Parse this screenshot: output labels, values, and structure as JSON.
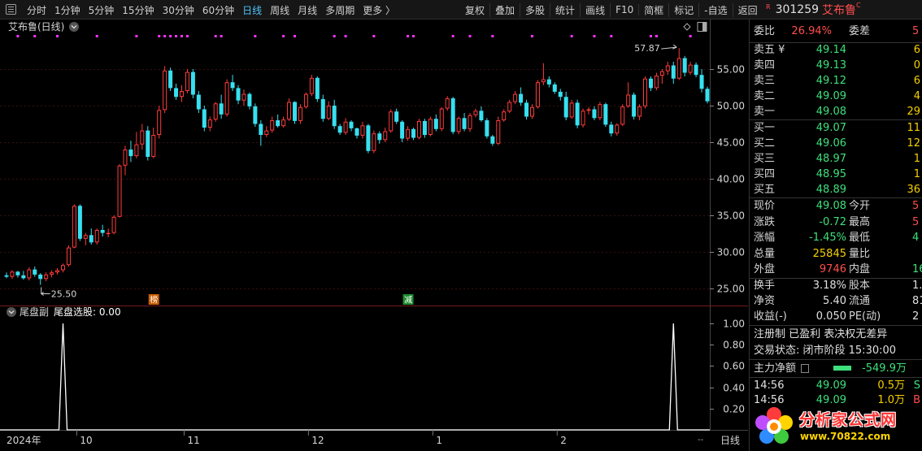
{
  "toolbar": {
    "periods": [
      "分时",
      "1分钟",
      "5分钟",
      "15分钟",
      "30分钟",
      "60分钟",
      "日线",
      "周线",
      "月线",
      "多周期",
      "更多 〉"
    ],
    "active_period": "日线",
    "tools": [
      "复权",
      "叠加",
      "多股",
      "统计",
      "画线",
      "F10",
      "简框",
      "标记",
      "-自选",
      "返回"
    ]
  },
  "stock": {
    "badge": "R",
    "code": "301259",
    "name": "艾布鲁",
    "suffix": "C"
  },
  "main_chart": {
    "title": "艾布鲁(日线)",
    "marker_bang": "榜",
    "marker_jian": "减",
    "max_price_label": "57.87",
    "min_price_label": "25.50"
  },
  "sub_chart": {
    "title": "尾盘副",
    "indicator": "尾盘选股: 0.00"
  },
  "x_axis": {
    "labels": [
      "2024年",
      "10",
      "11",
      "12",
      "1",
      "2"
    ],
    "period_box": "日线",
    "end_marker": "--"
  },
  "colors": {
    "up": "#ff3b3b",
    "down": "#37e0f0",
    "grid": "#3a1010",
    "dots": "#ff33ff"
  },
  "chart_data": [
    {
      "type": "candlestick",
      "title": "艾布鲁(日线)",
      "ylim": [
        24,
        59
      ],
      "yticks": [
        25.0,
        30.0,
        35.0,
        40.0,
        45.0,
        50.0,
        55.0
      ],
      "annotations": [
        {
          "text": "57.87",
          "kind": "high"
        },
        {
          "text": "25.50",
          "kind": "low"
        }
      ],
      "series": [
        {
          "values_ohlc": [
            [
              26.8,
              27.2,
              26.4,
              26.6
            ],
            [
              26.6,
              27.5,
              26.3,
              27.3
            ],
            [
              27.3,
              27.4,
              26.5,
              26.8
            ],
            [
              26.8,
              27.4,
              26.2,
              26.4
            ],
            [
              26.4,
              27.9,
              26.1,
              27.6
            ],
            [
              27.6,
              28.0,
              26.6,
              26.9
            ],
            [
              26.9,
              27.1,
              25.5,
              26.3
            ],
            [
              26.3,
              27.2,
              26.0,
              26.9
            ],
            [
              26.9,
              27.5,
              26.5,
              27.2
            ],
            [
              27.2,
              27.8,
              26.9,
              27.5
            ],
            [
              27.5,
              28.4,
              27.2,
              28.2
            ],
            [
              28.2,
              30.9,
              28.0,
              30.6
            ],
            [
              30.6,
              36.5,
              30.5,
              36.3
            ],
            [
              36.3,
              36.5,
              31.5,
              31.8
            ],
            [
              31.8,
              32.6,
              30.9,
              32.3
            ],
            [
              32.3,
              33.2,
              31.0,
              31.3
            ],
            [
              31.3,
              33.2,
              31.0,
              33.0
            ],
            [
              33.0,
              33.7,
              32.1,
              32.6
            ],
            [
              32.6,
              33.2,
              32.0,
              32.6
            ],
            [
              32.6,
              35.0,
              32.4,
              34.8
            ],
            [
              34.8,
              42.0,
              34.7,
              41.8
            ],
            [
              41.8,
              44.5,
              40.5,
              44.0
            ],
            [
              44.0,
              45.2,
              42.3,
              43.1
            ],
            [
              43.1,
              46.4,
              42.8,
              44.7
            ],
            [
              44.7,
              47.5,
              44.0,
              46.6
            ],
            [
              46.6,
              47.2,
              42.5,
              43.0
            ],
            [
              43.0,
              47.0,
              42.8,
              46.0
            ],
            [
              46.0,
              50.0,
              45.5,
              49.4
            ],
            [
              49.4,
              55.4,
              49.0,
              54.8
            ],
            [
              54.8,
              55.2,
              52.0,
              52.4
            ],
            [
              52.4,
              53.0,
              50.8,
              51.2
            ],
            [
              51.2,
              52.8,
              50.5,
              52.0
            ],
            [
              52.0,
              55.0,
              51.7,
              54.6
            ],
            [
              54.6,
              55.0,
              51.0,
              51.5
            ],
            [
              51.5,
              52.0,
              49.0,
              49.5
            ],
            [
              49.5,
              50.0,
              46.5,
              47.0
            ],
            [
              47.0,
              48.5,
              46.5,
              48.1
            ],
            [
              48.1,
              50.5,
              47.8,
              50.3
            ],
            [
              50.3,
              51.5,
              48.2,
              48.8
            ],
            [
              48.8,
              53.6,
              48.5,
              53.2
            ],
            [
              53.2,
              54.2,
              52.0,
              52.4
            ],
            [
              52.4,
              52.8,
              50.2,
              50.7
            ],
            [
              50.7,
              52.2,
              50.0,
              51.6
            ],
            [
              51.6,
              51.8,
              49.5,
              49.9
            ],
            [
              49.9,
              50.3,
              47.1,
              47.5
            ],
            [
              47.5,
              48.0,
              44.5,
              46.0
            ],
            [
              46.0,
              47.2,
              45.7,
              46.6
            ],
            [
              46.6,
              48.5,
              46.3,
              48.0
            ],
            [
              48.0,
              48.8,
              47.0,
              47.2
            ],
            [
              47.2,
              48.5,
              47.0,
              48.1
            ],
            [
              48.1,
              51.0,
              47.9,
              50.5
            ],
            [
              50.5,
              50.6,
              47.5,
              47.9
            ],
            [
              47.9,
              50.2,
              47.5,
              49.8
            ],
            [
              49.8,
              51.8,
              49.6,
              51.6
            ],
            [
              51.6,
              54.2,
              51.3,
              53.8
            ],
            [
              53.8,
              54.0,
              50.5,
              50.9
            ],
            [
              50.9,
              51.5,
              47.8,
              48.2
            ],
            [
              48.2,
              50.6,
              48.0,
              50.0
            ],
            [
              50.0,
              50.8,
              46.8,
              47.2
            ],
            [
              47.2,
              47.5,
              46.0,
              46.3
            ],
            [
              46.3,
              48.3,
              46.0,
              47.8
            ],
            [
              47.8,
              48.0,
              46.5,
              46.9
            ],
            [
              46.9,
              47.0,
              45.5,
              45.9
            ],
            [
              45.9,
              47.8,
              45.5,
              47.3
            ],
            [
              47.3,
              47.5,
              43.5,
              43.8
            ],
            [
              43.8,
              46.6,
              43.5,
              46.2
            ],
            [
              46.2,
              46.5,
              44.8,
              45.3
            ],
            [
              45.3,
              47.0,
              45.0,
              46.5
            ],
            [
              46.5,
              49.5,
              46.3,
              49.2
            ],
            [
              49.2,
              49.6,
              47.5,
              47.8
            ],
            [
              47.8,
              48.0,
              45.0,
              45.5
            ],
            [
              45.5,
              47.2,
              45.2,
              46.8
            ],
            [
              46.8,
              47.0,
              45.3,
              45.6
            ],
            [
              45.6,
              48.2,
              45.4,
              47.9
            ],
            [
              47.9,
              48.2,
              45.6,
              46.0
            ],
            [
              46.0,
              48.5,
              45.8,
              48.2
            ],
            [
              48.2,
              48.8,
              46.5,
              46.8
            ],
            [
              46.8,
              49.8,
              46.5,
              49.6
            ],
            [
              49.6,
              51.3,
              49.3,
              51.0
            ],
            [
              51.0,
              51.2,
              46.1,
              46.4
            ],
            [
              46.4,
              48.5,
              46.1,
              48.3
            ],
            [
              48.3,
              49.0,
              46.5,
              46.8
            ],
            [
              46.8,
              49.0,
              46.4,
              48.7
            ],
            [
              48.7,
              49.6,
              48.4,
              49.3
            ],
            [
              49.3,
              49.9,
              47.8,
              48.0
            ],
            [
              48.0,
              48.3,
              45.5,
              45.8
            ],
            [
              45.8,
              46.0,
              44.5,
              44.8
            ],
            [
              44.8,
              48.5,
              44.6,
              48.0
            ],
            [
              48.0,
              49.5,
              47.8,
              49.2
            ],
            [
              49.2,
              50.8,
              49.0,
              50.5
            ],
            [
              50.5,
              52.0,
              50.2,
              51.6
            ],
            [
              51.6,
              52.5,
              50.0,
              50.4
            ],
            [
              50.4,
              50.8,
              48.1,
              48.5
            ],
            [
              48.5,
              50.2,
              48.2,
              49.8
            ],
            [
              49.8,
              53.5,
              49.6,
              53.2
            ],
            [
              53.2,
              55.8,
              52.8,
              53.6
            ],
            [
              53.6,
              54.0,
              52.5,
              52.9
            ],
            [
              52.9,
              53.2,
              51.6,
              51.9
            ],
            [
              51.9,
              52.3,
              50.7,
              51.2
            ],
            [
              51.2,
              51.9,
              48.0,
              48.4
            ],
            [
              48.4,
              50.8,
              48.2,
              50.4
            ],
            [
              50.4,
              50.8,
              46.9,
              47.3
            ],
            [
              47.3,
              49.6,
              47.0,
              49.3
            ],
            [
              49.3,
              49.8,
              48.8,
              49.5
            ],
            [
              49.5,
              49.9,
              48.0,
              48.3
            ],
            [
              48.3,
              50.5,
              48.0,
              50.2
            ],
            [
              50.2,
              50.4,
              47.1,
              47.4
            ],
            [
              47.4,
              47.8,
              45.8,
              46.2
            ],
            [
              46.2,
              47.6,
              45.9,
              47.4
            ],
            [
              47.4,
              50.2,
              47.2,
              49.9
            ],
            [
              49.9,
              53.2,
              49.7,
              51.5
            ],
            [
              51.5,
              51.8,
              48.1,
              48.5
            ],
            [
              48.5,
              50.2,
              48.0,
              49.9
            ],
            [
              49.9,
              54.0,
              49.6,
              53.7
            ],
            [
              53.7,
              54.0,
              52.0,
              52.4
            ],
            [
              52.4,
              54.5,
              52.1,
              54.1
            ],
            [
              54.1,
              55.0,
              53.0,
              54.7
            ],
            [
              54.7,
              56.0,
              54.2,
              55.5
            ],
            [
              55.5,
              56.0,
              53.0,
              53.7
            ],
            [
              53.7,
              57.87,
              53.5,
              56.5
            ],
            [
              56.5,
              56.8,
              54.0,
              54.5
            ],
            [
              54.5,
              56.0,
              54.2,
              55.6
            ],
            [
              55.6,
              55.9,
              53.9,
              54.2
            ],
            [
              54.2,
              55.0,
              51.8,
              52.3
            ],
            [
              52.3,
              52.6,
              50.3,
              50.6
            ]
          ]
        }
      ],
      "max": {
        "index": 119,
        "value": 57.87
      },
      "min": {
        "index": 6,
        "value": 25.5
      }
    },
    {
      "type": "line",
      "title": "尾盘副",
      "ylim": [
        0,
        1
      ],
      "yticks": [
        0.2,
        0.4,
        0.6,
        0.8,
        1.0
      ],
      "series": [
        {
          "name": "尾盘选股",
          "spikes_at": [
            10,
            118
          ],
          "baseline": 0,
          "peak": 1
        }
      ]
    }
  ],
  "panel": {
    "wb": {
      "label": "委比",
      "value": "26.94%",
      "label2": "委差",
      "value2": "5"
    },
    "sells": [
      {
        "label": "卖五 ¥",
        "price": "49.14",
        "vol": "6"
      },
      {
        "label": "卖四",
        "price": "49.13",
        "vol": "0"
      },
      {
        "label": "卖三",
        "price": "49.12",
        "vol": "6"
      },
      {
        "label": "卖二",
        "price": "49.09",
        "vol": "4"
      },
      {
        "label": "卖一",
        "price": "49.08",
        "vol": "29"
      }
    ],
    "buys": [
      {
        "label": "买一",
        "price": "49.07",
        "vol": "11"
      },
      {
        "label": "买二",
        "price": "49.06",
        "vol": "12"
      },
      {
        "label": "买三",
        "price": "48.97",
        "vol": "1"
      },
      {
        "label": "买四",
        "price": "48.95",
        "vol": "1"
      },
      {
        "label": "买五",
        "price": "48.89",
        "vol": "36"
      }
    ],
    "quote": [
      {
        "l1": "现价",
        "v1": "49.08",
        "c1": "green",
        "l2": "今开",
        "v2": "5",
        "c2": "red"
      },
      {
        "l1": "涨跌",
        "v1": "-0.72",
        "c1": "green",
        "l2": "最高",
        "v2": "5",
        "c2": "red"
      },
      {
        "l1": "涨幅",
        "v1": "-1.45%",
        "c1": "green",
        "l2": "最低",
        "v2": "4",
        "c2": "green"
      },
      {
        "l1": "总量",
        "v1": "25845",
        "c1": "yellow",
        "l2": "量比",
        "v2": "",
        "c2": "white"
      },
      {
        "l1": "外盘",
        "v1": "9746",
        "c1": "red",
        "l2": "内盘",
        "v2": "16",
        "c2": "green"
      }
    ],
    "stats": [
      {
        "l1": "换手",
        "v1": "3.18%",
        "l2": "股本",
        "v2": "1."
      },
      {
        "l1": "净资",
        "v1": "5.40",
        "l2": "流通",
        "v2": "81"
      },
      {
        "l1": "收益(-)",
        "v1": "0.050",
        "l2": "PE(动)",
        "v2": "2"
      }
    ],
    "registration": "注册制 已盈利 表决权无差异",
    "trade_status": "交易状态: 闭市阶段 15:30:00",
    "main_flow": {
      "label": "主力净额",
      "value": "-549.9万"
    },
    "ticks": [
      {
        "time": "14:56",
        "price": "49.09",
        "vol": "0.5万",
        "side": "S"
      },
      {
        "time": "14:56",
        "price": "49.09",
        "vol": "1.0万",
        "side": "B"
      }
    ]
  },
  "logo": {
    "text": "分析家公式网",
    "url": "www.70822.com"
  }
}
